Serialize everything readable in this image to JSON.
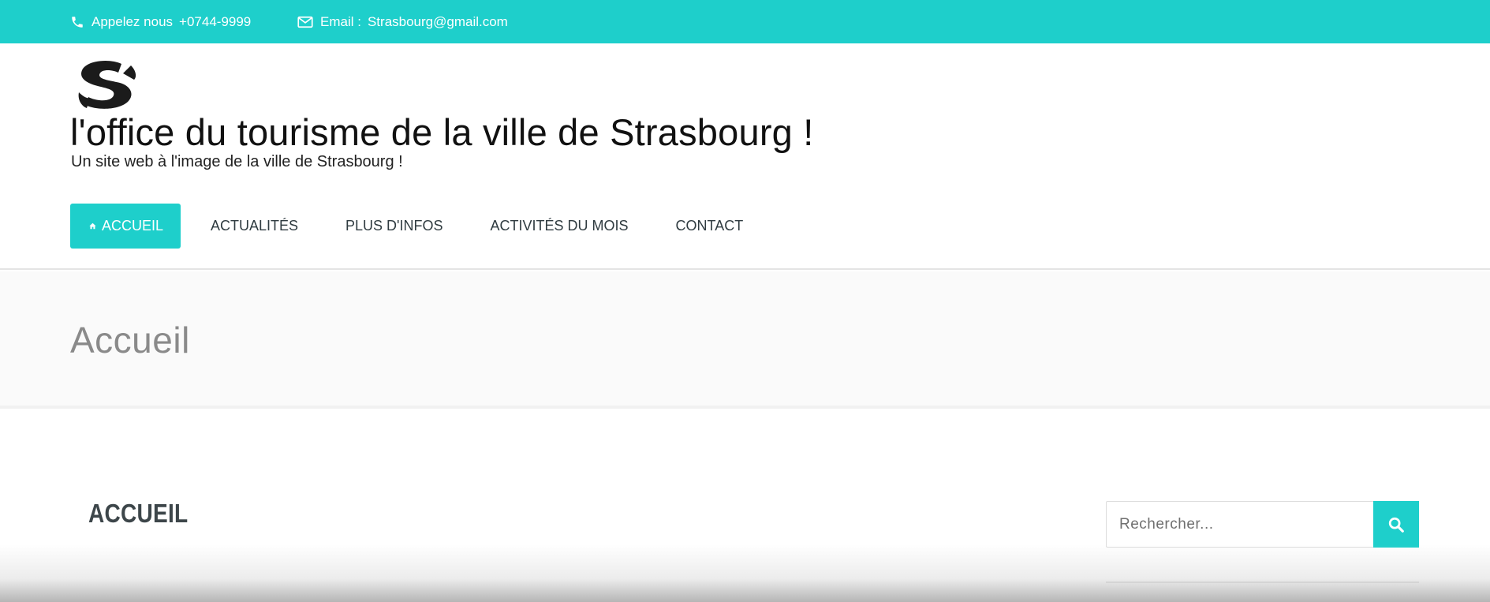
{
  "topbar": {
    "phone_label": "Appelez nous",
    "phone_number": "+0744-9999",
    "email_label": "Email :",
    "email_address": "Strasbourg@gmail.com",
    "icons": [
      "phone-icon",
      "envelope-icon"
    ]
  },
  "header": {
    "logo_icon": "strasbourg-s-logo",
    "title": "l'office du tourisme de la ville de Strasbourg !",
    "tagline": "Un site web à l'image de la ville de Strasbourg !"
  },
  "nav": {
    "items": [
      {
        "label": "ACCUEIL",
        "active": true,
        "icon": "home-icon"
      },
      {
        "label": "ACTUALITÉS",
        "active": false
      },
      {
        "label": "PLUS D'INFOS",
        "active": false
      },
      {
        "label": "ACTIVITÉS DU MOIS",
        "active": false
      },
      {
        "label": "CONTACT",
        "active": false
      }
    ]
  },
  "page": {
    "heading": "Accueil"
  },
  "content": {
    "heading": "ACCUEIL"
  },
  "sidebar": {
    "search_placeholder": "Rechercher...",
    "search_icon": "search-icon"
  },
  "colors": {
    "accent": "#1ecfcb",
    "text_dark": "#2f3b40",
    "heading_gray": "#8a8a8a",
    "band_bg": "#fafafa"
  }
}
